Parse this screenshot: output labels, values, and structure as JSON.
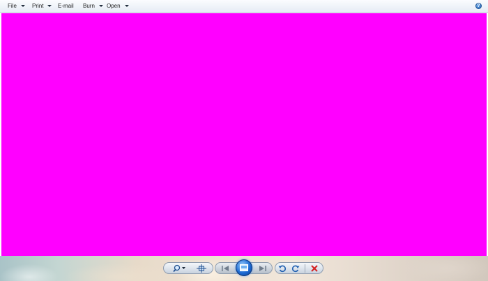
{
  "menu": {
    "file": "File",
    "print": "Print",
    "email": "E-mail",
    "burn": "Burn",
    "open": "Open"
  },
  "help": {
    "glyph": "?"
  },
  "photo": {
    "fill_color": "#ff00ff"
  },
  "toolbar": {
    "icons": [
      "zoom-icon",
      "actual-size-icon",
      "previous-icon",
      "slideshow-icon",
      "next-icon",
      "rotate-counterclockwise-icon",
      "rotate-clockwise-icon",
      "delete-icon"
    ]
  }
}
